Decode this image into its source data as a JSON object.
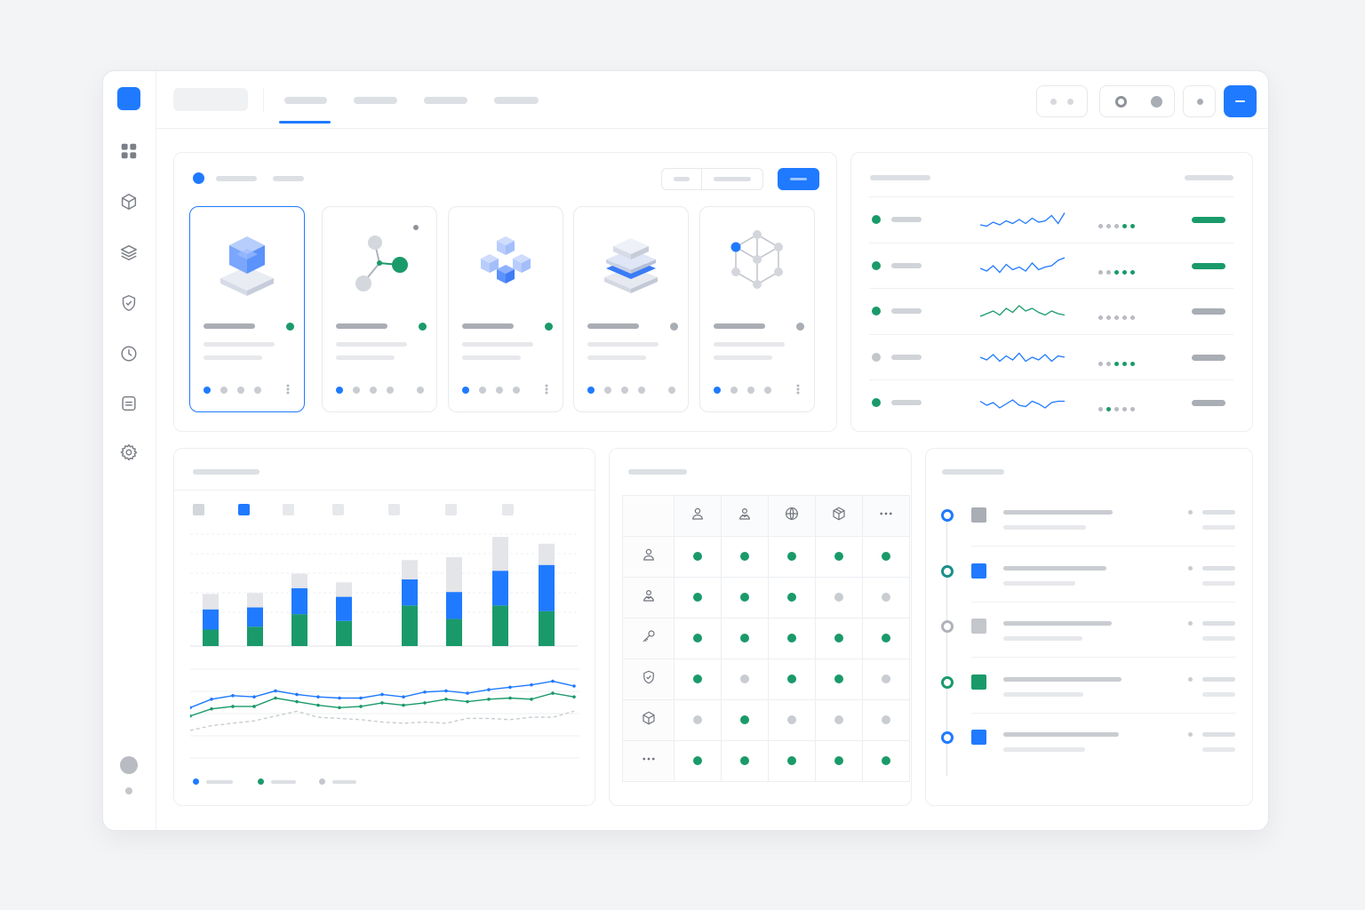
{
  "app": {
    "accent": "#1f7aff",
    "success": "#1a9a6a",
    "neutral": "#b0b3b9"
  },
  "sidebar": {
    "items": [
      {
        "icon": "grid-icon"
      },
      {
        "icon": "cube-icon"
      },
      {
        "icon": "layers-icon"
      },
      {
        "icon": "shield-check-icon"
      },
      {
        "icon": "clock-icon"
      },
      {
        "icon": "document-icon"
      },
      {
        "icon": "gear-icon"
      }
    ]
  },
  "header": {
    "tabs": [
      {
        "active": true
      },
      {
        "active": false
      },
      {
        "active": false
      },
      {
        "active": false
      }
    ]
  },
  "cards": [
    {
      "icon": "stacked-cube-icon",
      "status": "green",
      "selected": true
    },
    {
      "icon": "molecule-icon",
      "status": "green",
      "selected": false
    },
    {
      "icon": "cube-cluster-icon",
      "status": "green",
      "selected": false
    },
    {
      "icon": "layered-stack-icon",
      "status": "gray",
      "selected": false
    },
    {
      "icon": "network-cube-icon",
      "status": "gray",
      "selected": false
    }
  ],
  "monitor_rows": [
    {
      "status": "green",
      "spark_color": "#1f7aff",
      "mini": [
        "g",
        "g",
        "g",
        "green",
        "green"
      ],
      "pill": "green"
    },
    {
      "status": "green",
      "spark_color": "#1f7aff",
      "mini": [
        "g",
        "g",
        "green",
        "green",
        "green"
      ],
      "pill": "green"
    },
    {
      "status": "green",
      "spark_color": "#1a9a6a",
      "mini": [
        "g",
        "g",
        "g",
        "g",
        "g"
      ],
      "pill": "gray"
    },
    {
      "status": "gray",
      "spark_color": "#1f7aff",
      "mini": [
        "g",
        "g",
        "green",
        "green",
        "green"
      ],
      "pill": "gray"
    },
    {
      "status": "green",
      "spark_color": "#1f7aff",
      "mini": [
        "g",
        "green",
        "g",
        "g",
        "g"
      ],
      "pill": "gray"
    }
  ],
  "chart_data": {
    "type": "bar",
    "categories": [
      "",
      "",
      "",
      "",
      "",
      "",
      "",
      ""
    ],
    "series": [
      {
        "color": "#1a9a6a",
        "values": [
          17,
          20,
          33,
          26,
          42,
          28,
          42,
          36
        ]
      },
      {
        "color": "#1f7aff",
        "values": [
          21,
          20,
          27,
          25,
          27,
          28,
          36,
          48
        ]
      },
      {
        "color": "#e4e5e8",
        "values": [
          16,
          15,
          15,
          15,
          20,
          36,
          35,
          22
        ]
      }
    ],
    "lines": [
      {
        "color": "#1f7aff",
        "style": "solid",
        "values": [
          42,
          49,
          52,
          51,
          56,
          53,
          51,
          50,
          50,
          53,
          51,
          55,
          56,
          54,
          57,
          59,
          61,
          64,
          60
        ]
      },
      {
        "color": "#1a9a6a",
        "style": "solid",
        "values": [
          35,
          41,
          43,
          43,
          50,
          47,
          44,
          42,
          43,
          46,
          44,
          46,
          49,
          47,
          49,
          50,
          49,
          54,
          51
        ]
      },
      {
        "color": "#c9ccd1",
        "style": "dashed",
        "values": [
          23,
          27,
          29,
          31,
          35,
          39,
          34,
          33,
          32,
          30,
          29,
          30,
          29,
          33,
          33,
          32,
          34,
          34,
          39
        ]
      }
    ]
  },
  "permissions": {
    "columns": [
      "user-icon",
      "user-group-icon",
      "globe-icon",
      "package-icon",
      "more-icon"
    ],
    "rows": [
      {
        "icon": "user-icon",
        "cells": [
          "g",
          "g",
          "g",
          "g",
          "g"
        ]
      },
      {
        "icon": "user-group-icon",
        "cells": [
          "g",
          "g",
          "g",
          "x",
          "x"
        ]
      },
      {
        "icon": "key-icon",
        "cells": [
          "g",
          "g",
          "g",
          "g",
          "g"
        ]
      },
      {
        "icon": "shield-check-icon",
        "cells": [
          "g",
          "x",
          "g",
          "g",
          "x"
        ]
      },
      {
        "icon": "cube-icon",
        "cells": [
          "x",
          "g",
          "x",
          "x",
          "x"
        ]
      },
      {
        "icon": "more-icon",
        "cells": [
          "g",
          "g",
          "g",
          "g",
          "g"
        ]
      }
    ]
  },
  "timeline": [
    {
      "node": "#1f7aff",
      "square": "#a9adb4"
    },
    {
      "node": "#1a8f8a",
      "square": "#1f7aff"
    },
    {
      "node": "#b0b3b9",
      "square": "#c3c6cb"
    },
    {
      "node": "#1a9a6a",
      "square": "#1a9a6a"
    },
    {
      "node": "#1f7aff",
      "square": "#1f7aff"
    }
  ]
}
